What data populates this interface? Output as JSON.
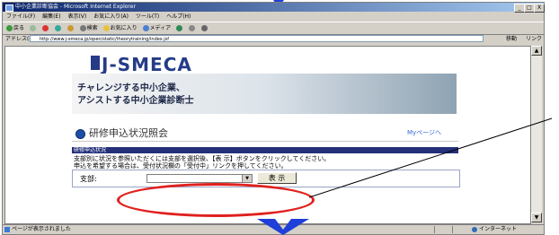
{
  "window": {
    "title": "中小企業診断協会 - Microsoft Internet Explorer",
    "minimize": "_",
    "maximize": "□",
    "close": "X"
  },
  "menu": [
    "ファイル(F)",
    "編集(E)",
    "表示(V)",
    "お気に入り(A)",
    "ツール(T)",
    "ヘルプ(H)"
  ],
  "toolbar": {
    "back": "戻る",
    "search": "検索",
    "favorites": "お気に入り",
    "media": "メディア"
  },
  "address": {
    "label": "アドレス(D)",
    "url": "http://www.j-smeca.jp/open/static/theorytraining/index.jsf",
    "go": "移動",
    "links": "リンク"
  },
  "page": {
    "logo": "J-SMECA",
    "banner_line1": "チャレンジする中小企業、",
    "banner_line2": "アシストする中小企業診断士",
    "section_title": "研修申込状況照会",
    "mypage_link": "Myページへ",
    "info_heading": "研修申込状況",
    "desc_line1": "支部別に状況を参照いただくには支部を選択後、【表 示】ボタンをクリックしてください。",
    "desc_line2": "申込を希望する場合は、受付状況欄の「受付中」リンクを押してください。",
    "form": {
      "branch_label": "支部:",
      "branch_value": "",
      "show_button": "表 示"
    }
  },
  "status": {
    "text": "ページが表示されました",
    "zone": "インターネット"
  },
  "colors": {
    "accent": "#253b87",
    "callout": "#e0211e",
    "arrow": "#1f3fd8"
  }
}
